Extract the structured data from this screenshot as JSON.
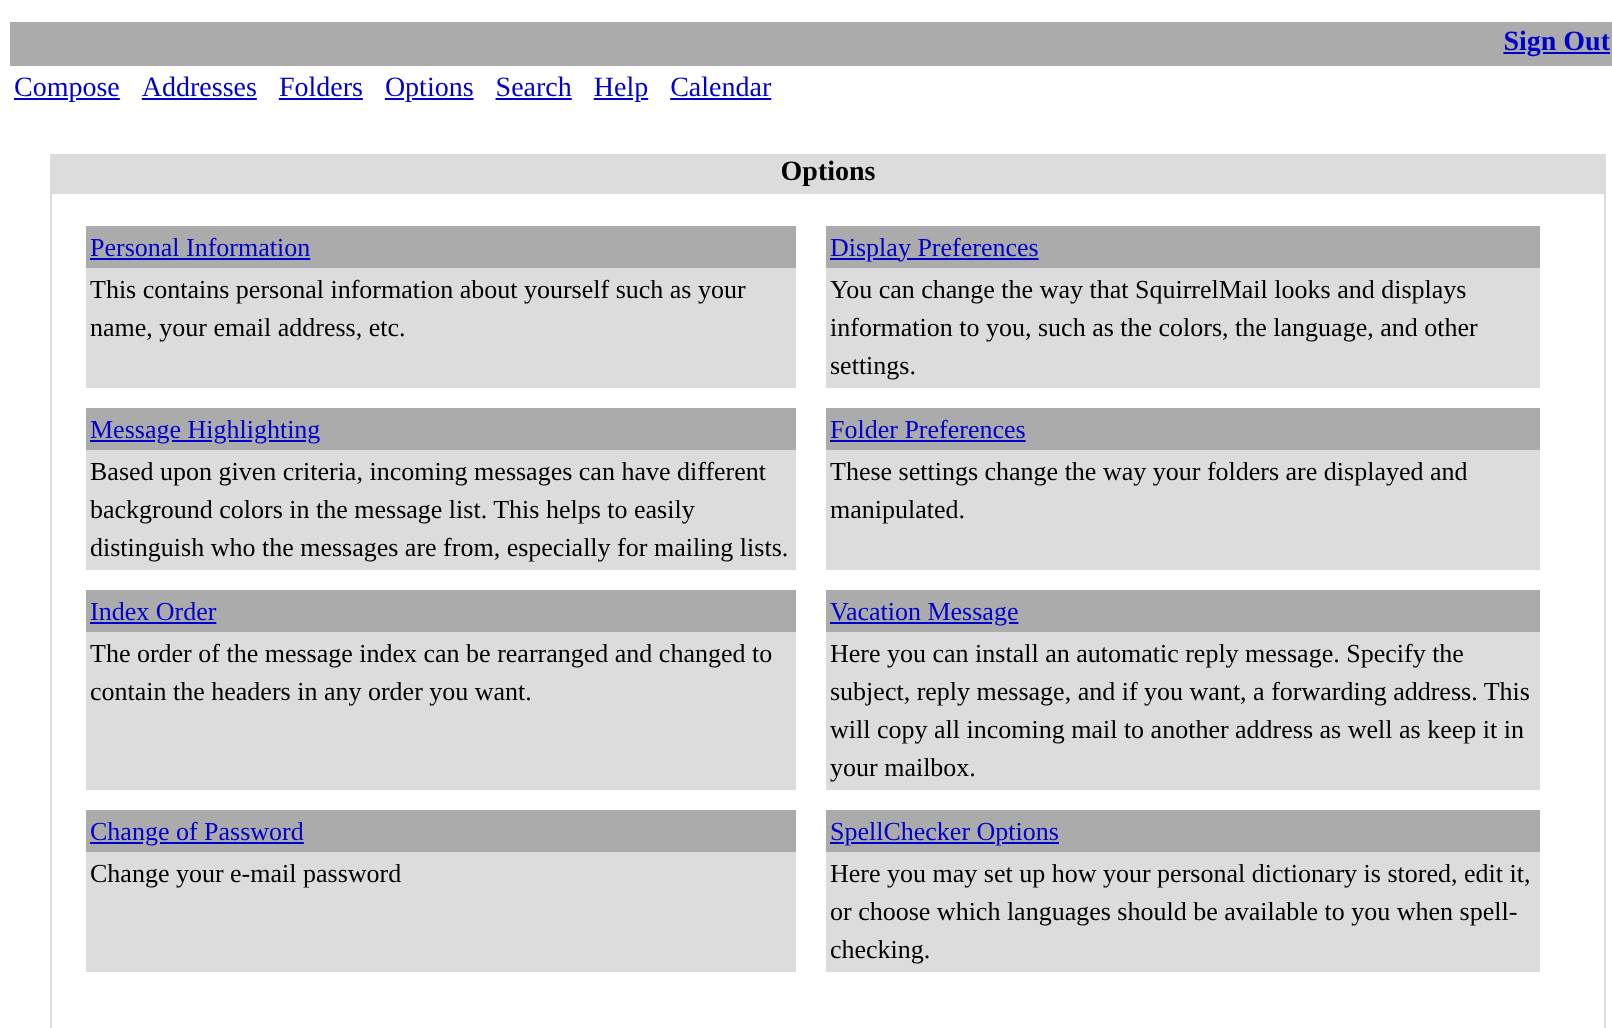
{
  "top_bar": {
    "sign_out": "Sign Out"
  },
  "nav_links": [
    "Compose",
    "Addresses",
    "Folders",
    "Options",
    "Search",
    "Help",
    "Calendar"
  ],
  "panel": {
    "title": "Options",
    "sections": [
      {
        "title": "Personal Information",
        "description": "This contains personal information about yourself such as your name, your email address, etc."
      },
      {
        "title": "Display Preferences",
        "description": "You can change the way that SquirrelMail looks and displays information to you, such as the colors, the language, and other settings."
      },
      {
        "title": "Message Highlighting",
        "description": "Based upon given criteria, incoming messages can have different background colors in the message list. This helps to easily distinguish who the messages are from, especially for mailing lists."
      },
      {
        "title": "Folder Preferences",
        "description": "These settings change the way your folders are displayed and manipulated."
      },
      {
        "title": "Index Order",
        "description": "The order of the message index can be rearranged and changed to contain the headers in any order you want."
      },
      {
        "title": "Vacation Message",
        "description": "Here you can install an automatic reply message. Specify the subject, reply message, and if you want, a forwarding address. This will copy all incoming mail to another address as well as keep it in your mailbox."
      },
      {
        "title": "Change of Password",
        "description": "Change your e-mail password"
      },
      {
        "title": "SpellChecker Options",
        "description": "Here you may set up how your personal dictionary is stored, edit it, or choose which languages should be available to you when spell-checking."
      }
    ]
  }
}
